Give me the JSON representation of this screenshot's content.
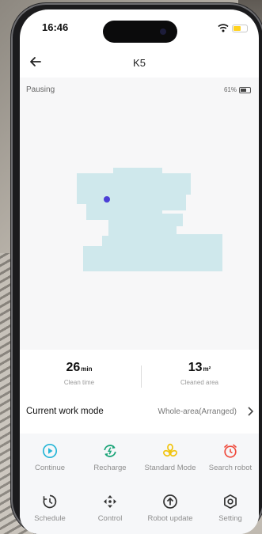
{
  "status_bar": {
    "time": "16:46"
  },
  "header": {
    "title": "K5"
  },
  "robot": {
    "state": "Pausing",
    "battery_text": "61%",
    "battery_level": 0.61
  },
  "stats": {
    "clean_time": {
      "value": "26",
      "unit": "min",
      "label": "Clean time"
    },
    "cleaned_area": {
      "value": "13",
      "unit": "m²",
      "label": "Cleaned area"
    }
  },
  "work_mode": {
    "label": "Current work mode",
    "value": "Whole-area(Arranged)"
  },
  "actions_row1": [
    {
      "label": "Continue",
      "icon": "play-circle-icon",
      "color": "#27b6d7"
    },
    {
      "label": "Recharge",
      "icon": "recharge-icon",
      "color": "#1aa478"
    },
    {
      "label": "Standard Mode",
      "icon": "fan-icon",
      "color": "#f1c40f"
    },
    {
      "label": "Search robot",
      "icon": "alarm-icon",
      "color": "#ef4a3c"
    }
  ],
  "actions_row2": [
    {
      "label": "Schedule",
      "icon": "schedule-clock-icon",
      "color": "#333333"
    },
    {
      "label": "Control",
      "icon": "directional-arrows-icon",
      "color": "#333333"
    },
    {
      "label": "Robot update",
      "icon": "upload-arrow-icon",
      "color": "#333333"
    },
    {
      "label": "Setting",
      "icon": "gear-icon",
      "color": "#333333"
    }
  ],
  "map": {
    "cleaned_area_color": "#cfe8ec",
    "robot_color": "#4b3fd6"
  }
}
